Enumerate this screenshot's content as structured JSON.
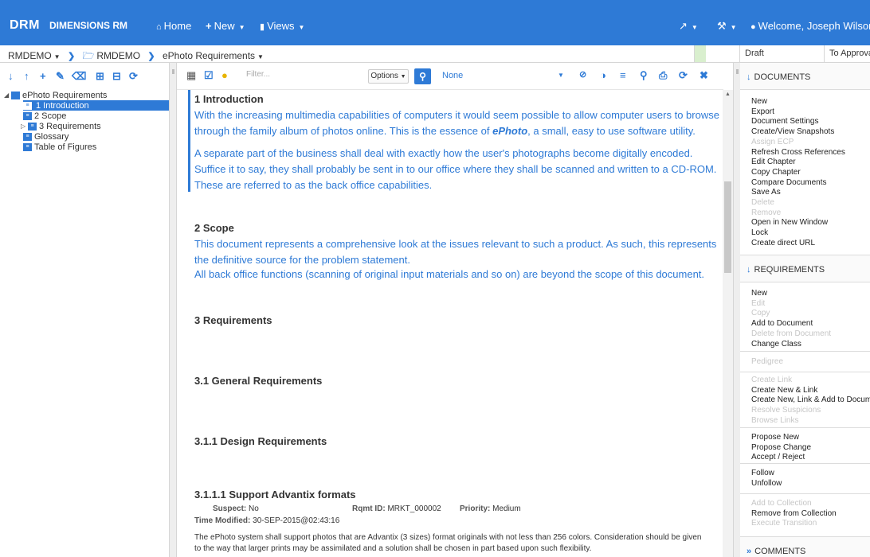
{
  "topbar": {
    "logo_short": "DRM",
    "logo_name": "DIMENSIONS RM",
    "home": "Home",
    "new": "New",
    "views": "Views",
    "welcome": "Welcome, Joseph Wilson"
  },
  "breadcrumb": {
    "project": "RMDEMO",
    "folder": "RMDEMO",
    "document": "ePhoto Requirements"
  },
  "status": {
    "state": "Draft",
    "next": "To Approval"
  },
  "tree": {
    "root": "ePhoto Requirements",
    "items": [
      "1 Introduction",
      "2 Scope",
      "3 Requirements",
      "Glossary",
      "Table of Figures"
    ]
  },
  "toolbar": {
    "filter_placeholder": "Filter...",
    "options": "Options",
    "none": "None"
  },
  "document": {
    "intro_heading": "1 Introduction",
    "intro_p1_a": "With the increasing multimedia capabilities of computers it would seem possible to allow computer users to browse through the family album of photos online. This is the essence of ",
    "intro_p1_brand": "ePhoto",
    "intro_p1_b": ", a small, easy to use software utility.",
    "intro_p2": "A separate part of the business shall deal with exactly how the user's photographs become digitally encoded. Suffice it to say, they shall probably be sent in to our office where they shall be scanned and written to a CD-ROM. These are referred to as the back office capabilities.",
    "scope_heading": "2 Scope",
    "scope_p1": "This document represents a comprehensive look at the issues relevant to such a product. As such, this represents the definitive source for the problem statement.",
    "scope_p2": "All back office functions (scanning of original input materials and so on) are beyond the scope of this document.",
    "req_heading": "3 Requirements",
    "gen_heading": "3.1 General Requirements",
    "design_heading": "3.1.1 Design Requirements",
    "adv_heading": "3.1.1.1 Support Advantix formats",
    "meta": {
      "suspect_label": "Suspect:",
      "suspect": "No",
      "rqmt_label": "Rqmt ID:",
      "rqmt": "MRKT_000002",
      "priority_label": "Priority:",
      "priority": "Medium",
      "time_label": "Time Modified:",
      "time": "30-SEP-2015@02:43:16"
    },
    "adv_text": "The ePhoto system shall support photos that are Advantix (3 sizes) format originals with not less than 256 colors. Consideration should be given to the way that larger prints may be assimilated and a solution shall be chosen in part based upon such flexibility."
  },
  "right": {
    "documents_header": "DOCUMENTS",
    "documents_items": [
      {
        "label": "New",
        "enabled": true
      },
      {
        "label": "Export",
        "enabled": true
      },
      {
        "label": "Document Settings",
        "enabled": true
      },
      {
        "label": "Create/View Snapshots",
        "enabled": true
      },
      {
        "label": "Assign ECP",
        "enabled": false
      },
      {
        "label": "Refresh Cross References",
        "enabled": true
      },
      {
        "label": "Edit Chapter",
        "enabled": true
      },
      {
        "label": "Copy Chapter",
        "enabled": true
      },
      {
        "label": "Compare Documents",
        "enabled": true
      },
      {
        "label": "Save As",
        "enabled": true
      },
      {
        "label": "Delete",
        "enabled": false
      },
      {
        "label": "Remove",
        "enabled": false
      },
      {
        "label": "Open in New Window",
        "enabled": true
      },
      {
        "label": "Lock",
        "enabled": true
      },
      {
        "label": "Create direct URL",
        "enabled": true
      }
    ],
    "requirements_header": "REQUIREMENTS",
    "req_group1": [
      {
        "label": "New",
        "enabled": true
      },
      {
        "label": "Edit",
        "enabled": false
      },
      {
        "label": "Copy",
        "enabled": false
      },
      {
        "label": "Add to Document",
        "enabled": true
      },
      {
        "label": "Delete from Document",
        "enabled": false
      },
      {
        "label": "Change Class",
        "enabled": true
      }
    ],
    "req_group2": [
      {
        "label": "Pedigree",
        "enabled": false
      }
    ],
    "req_group3": [
      {
        "label": "Create Link",
        "enabled": false
      },
      {
        "label": "Create New & Link",
        "enabled": true
      },
      {
        "label": "Create New, Link & Add to Document",
        "enabled": true
      },
      {
        "label": "Resolve Suspicions",
        "enabled": false
      },
      {
        "label": "Browse Links",
        "enabled": false
      }
    ],
    "req_group4": [
      {
        "label": "Propose New",
        "enabled": true
      },
      {
        "label": "Propose Change",
        "enabled": true
      },
      {
        "label": "Accept / Reject",
        "enabled": true
      }
    ],
    "req_group5": [
      {
        "label": "Follow",
        "enabled": true
      },
      {
        "label": "Unfollow",
        "enabled": true
      }
    ],
    "req_group6": [
      {
        "label": "Add to Collection",
        "enabled": false
      },
      {
        "label": "Remove from Collection",
        "enabled": true
      },
      {
        "label": "Execute Transition",
        "enabled": false
      }
    ],
    "comments_header": "COMMENTS"
  }
}
